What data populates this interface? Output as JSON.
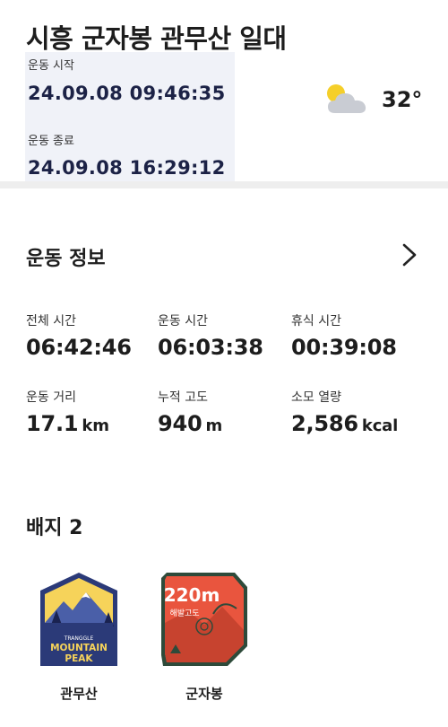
{
  "header": {
    "title": "시흥 군자봉 관무산 일대",
    "start_label": "운동 시작",
    "start_value": "24.09.08 09:46:35",
    "end_label": "운동 종료",
    "end_value": "24.09.08 16:29:12",
    "weather_icon": "partly-cloudy-icon",
    "temperature": "32°"
  },
  "info": {
    "title": "운동 정보",
    "stats": [
      {
        "label": "전체 시간",
        "value": "06:42:46",
        "unit": ""
      },
      {
        "label": "운동 시간",
        "value": "06:03:38",
        "unit": ""
      },
      {
        "label": "휴식 시간",
        "value": "00:39:08",
        "unit": ""
      },
      {
        "label": "운동 거리",
        "value": "17.1",
        "unit": "km"
      },
      {
        "label": "누적 고도",
        "value": "940",
        "unit": "m"
      },
      {
        "label": "소모 열량",
        "value": "2,586",
        "unit": "kcal"
      }
    ]
  },
  "badges": {
    "title": "배지 2",
    "items": [
      {
        "name": "관무산",
        "line1": "TRANGGLE",
        "line2": "MOUNTAIN",
        "line3": "PEAK"
      },
      {
        "name": "군자봉",
        "alt": "220m",
        "alt_label": "해발고도"
      }
    ]
  },
  "colors": {
    "time_panel_bg": "#f0f2f8",
    "time_value": "#1c2246",
    "badge1_bg": "#2b3a78",
    "badge1_sky": "#f6d35a",
    "badge2_fill": "#e9553e",
    "badge2_border": "#2e4a3a"
  }
}
